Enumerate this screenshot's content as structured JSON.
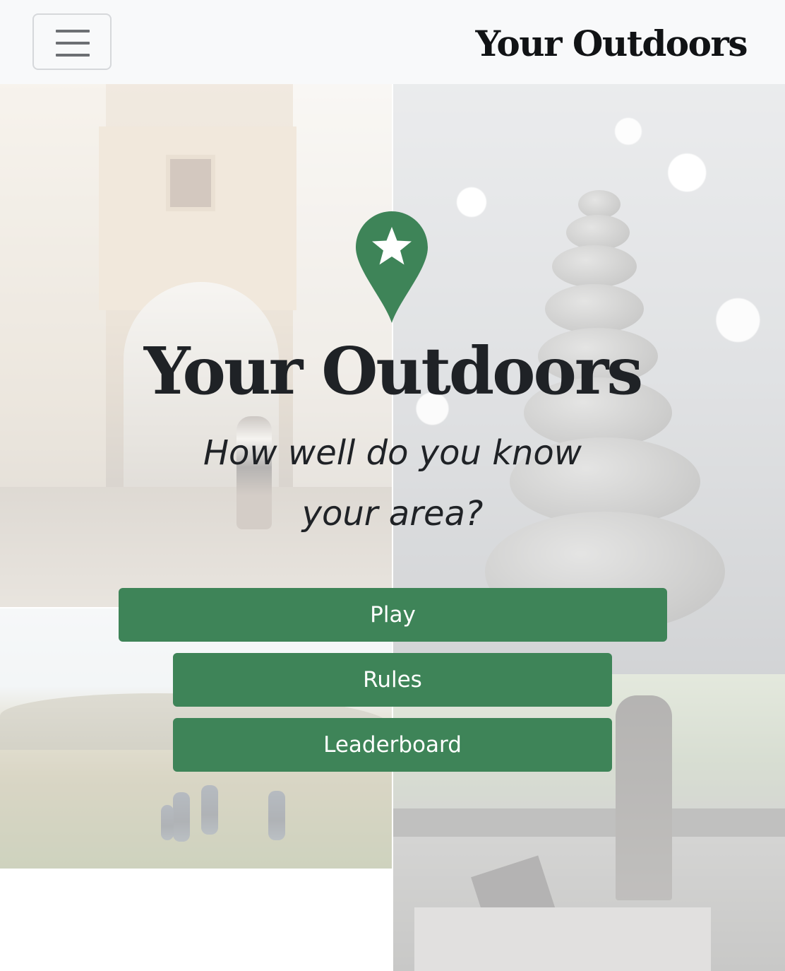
{
  "navbar": {
    "brand": "Your Outdoors",
    "toggle_icon": "hamburger-menu-icon"
  },
  "hero": {
    "icon": "map-pin-star-icon",
    "title": "Your Outdoors",
    "tagline": "How well do you know your area?"
  },
  "actions": {
    "play_label": "Play",
    "rules_label": "Rules",
    "leaderboard_label": "Leaderboard"
  },
  "colors": {
    "accent": "#3e8458",
    "navbar_bg": "#f8f9fa",
    "text_dark": "#1f2226"
  }
}
